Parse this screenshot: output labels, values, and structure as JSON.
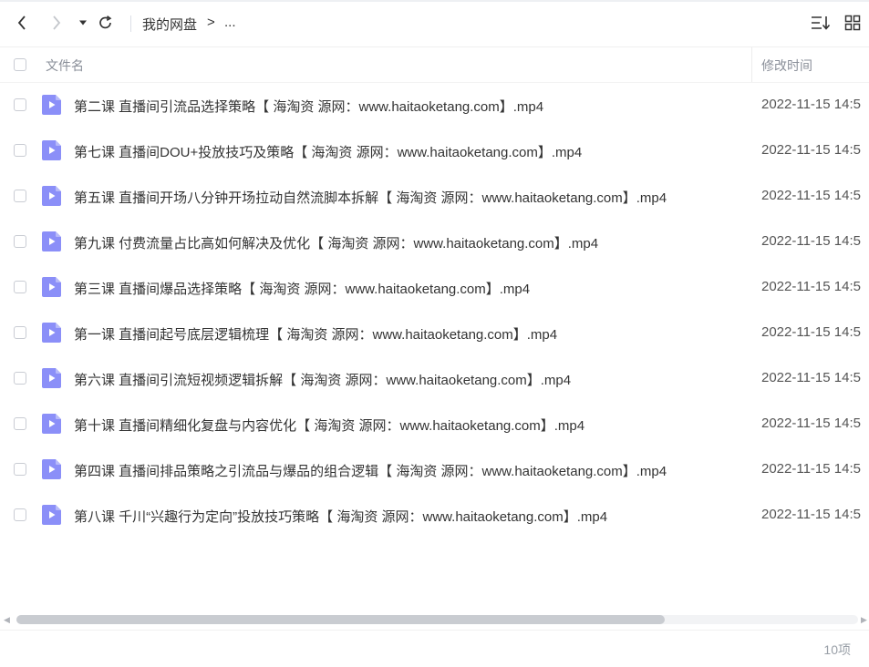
{
  "toolbar": {
    "breadcrumb_root": "我的网盘",
    "breadcrumb_sep": ">",
    "breadcrumb_more": "..."
  },
  "header": {
    "name_col": "文件名",
    "time_col": "修改时间"
  },
  "files": [
    {
      "name": "第二课 直播间引流品选择策略【 海淘资 源网：www.haitaoketang.com】.mp4",
      "time": "2022-11-15 14:5"
    },
    {
      "name": "第七课 直播间DOU+投放技巧及策略【 海淘资 源网：www.haitaoketang.com】.mp4",
      "time": "2022-11-15 14:5"
    },
    {
      "name": "第五课 直播间开场八分钟开场拉动自然流脚本拆解【 海淘资 源网：www.haitaoketang.com】.mp4",
      "time": "2022-11-15 14:5"
    },
    {
      "name": "第九课 付费流量占比高如何解决及优化【 海淘资 源网：www.haitaoketang.com】.mp4",
      "time": "2022-11-15 14:5"
    },
    {
      "name": "第三课 直播间爆品选择策略【 海淘资 源网：www.haitaoketang.com】.mp4",
      "time": "2022-11-15 14:5"
    },
    {
      "name": "第一课 直播间起号底层逻辑梳理【 海淘资 源网：www.haitaoketang.com】.mp4",
      "time": "2022-11-15 14:5"
    },
    {
      "name": "第六课 直播间引流短视频逻辑拆解【 海淘资 源网：www.haitaoketang.com】.mp4",
      "time": "2022-11-15 14:5"
    },
    {
      "name": "第十课 直播间精细化复盘与内容优化【 海淘资 源网：www.haitaoketang.com】.mp4",
      "time": "2022-11-15 14:5"
    },
    {
      "name": "第四课 直播间排品策略之引流品与爆品的组合逻辑【 海淘资 源网：www.haitaoketang.com】.mp4",
      "time": "2022-11-15 14:5"
    },
    {
      "name": "第八课 千川“兴趣行为定向”投放技巧策略【 海淘资 源网：www.haitaoketang.com】.mp4",
      "time": "2022-11-15 14:5"
    }
  ],
  "scrollbar": {
    "thumb_fraction": 0.77
  },
  "footer": {
    "count": "10项"
  },
  "colors": {
    "video_icon": "#8b8ff8",
    "text": "#333333",
    "muted": "#8a8f99"
  },
  "icons": [
    "back-arrow-icon",
    "forward-arrow-icon",
    "dropdown-caret-icon",
    "refresh-icon",
    "sort-icon",
    "grid-view-icon",
    "video-file-icon"
  ]
}
